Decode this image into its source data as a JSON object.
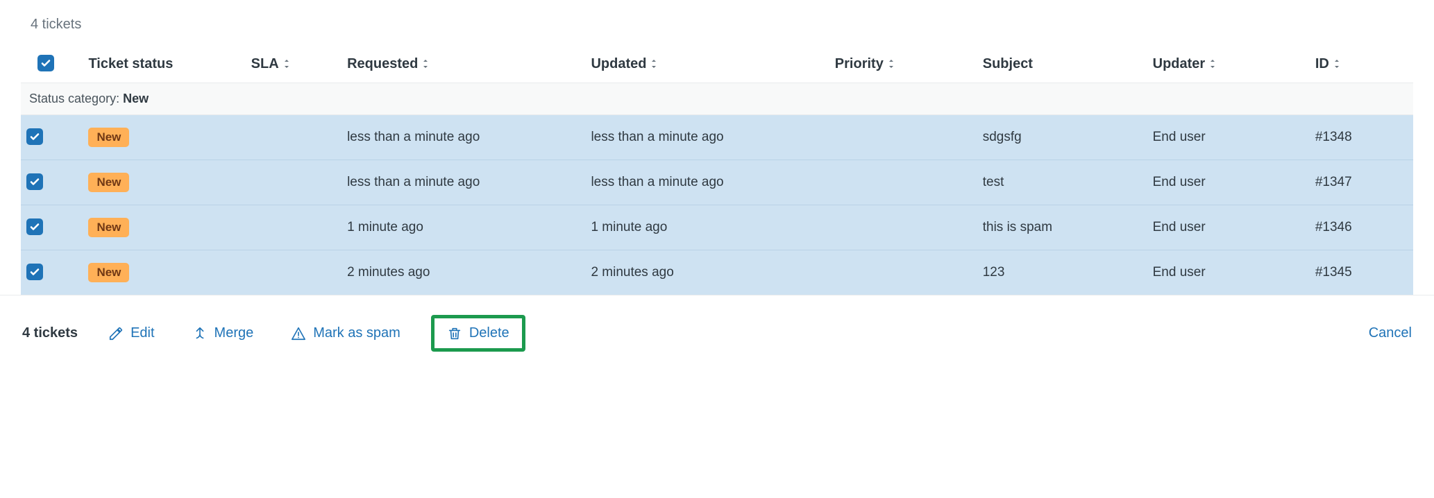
{
  "count_text": "4 tickets",
  "columns": {
    "status": {
      "label": "Ticket status",
      "sortable": false
    },
    "sla": {
      "label": "SLA",
      "sortable": true
    },
    "requested": {
      "label": "Requested",
      "sortable": true
    },
    "updated": {
      "label": "Updated",
      "sortable": true
    },
    "priority": {
      "label": "Priority",
      "sortable": true
    },
    "subject": {
      "label": "Subject",
      "sortable": false
    },
    "updater": {
      "label": "Updater",
      "sortable": true
    },
    "id": {
      "label": "ID",
      "sortable": true
    }
  },
  "group": {
    "label": "Status category:",
    "value": "New"
  },
  "rows": [
    {
      "checked": true,
      "status": "New",
      "sla": "",
      "requested": "less than a minute ago",
      "updated": "less than a minute ago",
      "priority": "",
      "subject": "sdgsfg",
      "updater": "End user",
      "id": "#1348"
    },
    {
      "checked": true,
      "status": "New",
      "sla": "",
      "requested": "less than a minute ago",
      "updated": "less than a minute ago",
      "priority": "",
      "subject": "test",
      "updater": "End user",
      "id": "#1347"
    },
    {
      "checked": true,
      "status": "New",
      "sla": "",
      "requested": "1 minute ago",
      "updated": "1 minute ago",
      "priority": "",
      "subject": "this is spam",
      "updater": "End user",
      "id": "#1346"
    },
    {
      "checked": true,
      "status": "New",
      "sla": "",
      "requested": "2 minutes ago",
      "updated": "2 minutes ago",
      "priority": "",
      "subject": "123",
      "updater": "End user",
      "id": "#1345"
    }
  ],
  "toolbar": {
    "selection": "4 tickets",
    "edit": "Edit",
    "merge": "Merge",
    "spam": "Mark as spam",
    "delete": "Delete",
    "cancel": "Cancel"
  },
  "colors": {
    "accent": "#1f73b7",
    "badge_bg": "#ffb057",
    "badge_fg": "#703815",
    "row_selected_bg": "#cee2f2",
    "highlight_border": "#1c9a4e"
  }
}
